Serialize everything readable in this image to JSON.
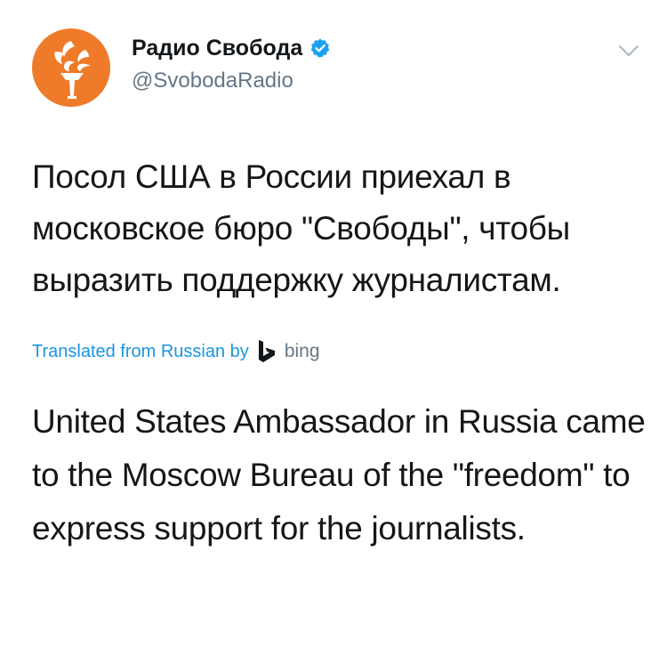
{
  "author": {
    "display_name": "Радио Свобода",
    "handle": "@SvobodaRadio",
    "avatar_icon": "radio-svoboda-torch-logo-icon",
    "avatar_color": "#ef7b2a",
    "verified_icon": "verified-badge-icon",
    "verified_color": "#1da1f2"
  },
  "menu": {
    "icon": "chevron-down-icon"
  },
  "tweet": {
    "text": "Посол США в России приехал в московское бюро \"Свободы\", чтобы выразить поддержку журналистам."
  },
  "translation": {
    "label": "Translated from Russian by",
    "provider_icon": "bing-logo-icon",
    "provider": "bing",
    "link_color": "#1b95e0",
    "text": "United States Ambassador in Russia came to the Moscow Bureau of the \"freedom\" to express support for the journalists."
  }
}
